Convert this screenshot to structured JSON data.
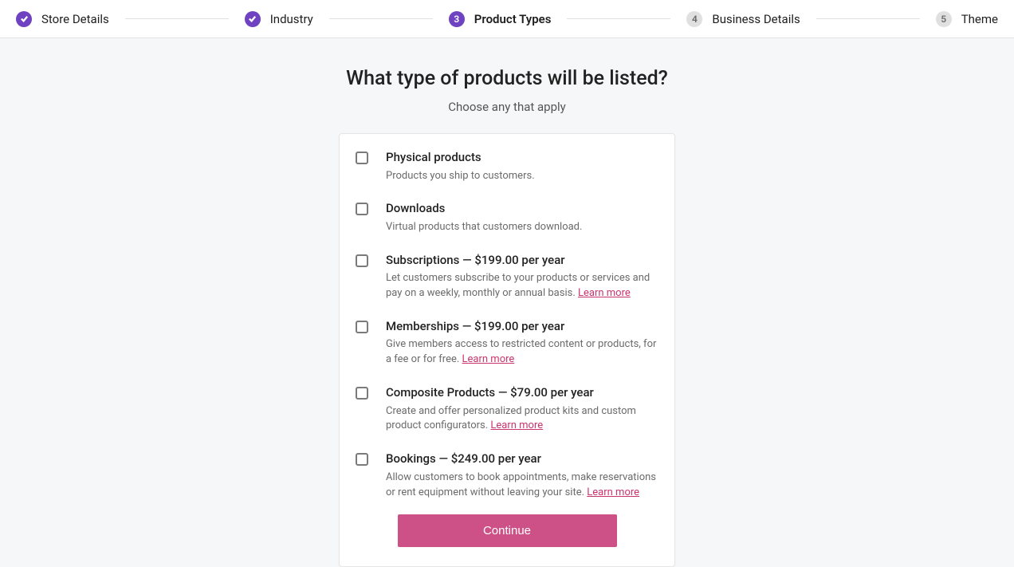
{
  "stepper": {
    "steps": [
      {
        "label": "Store Details",
        "status": "done"
      },
      {
        "label": "Industry",
        "status": "done"
      },
      {
        "label": "Product Types",
        "status": "current",
        "number": "3"
      },
      {
        "label": "Business Details",
        "status": "pending",
        "number": "4"
      },
      {
        "label": "Theme",
        "status": "pending",
        "number": "5"
      }
    ]
  },
  "headline": "What type of products will be listed?",
  "subhead": "Choose any that apply",
  "options": {
    "physical": {
      "title": "Physical products",
      "desc": "Products you ship to customers."
    },
    "downloads": {
      "title": "Downloads",
      "desc": "Virtual products that customers download."
    },
    "subscriptions": {
      "title": "Subscriptions — $199.00 per year",
      "desc": "Let customers subscribe to your products or services and pay on a weekly, monthly or annual basis. "
    },
    "memberships": {
      "title": "Memberships — $199.00 per year",
      "desc": "Give members access to restricted content or products, for a fee or for free. "
    },
    "composite": {
      "title": "Composite Products — $79.00 per year",
      "desc": "Create and offer personalized product kits and custom product configurators. "
    },
    "bookings": {
      "title": "Bookings — $249.00 per year",
      "desc": "Allow customers to book appointments, make reservations or rent equipment without leaving your site. "
    }
  },
  "learn_more": "Learn more",
  "continue_label": "Continue"
}
